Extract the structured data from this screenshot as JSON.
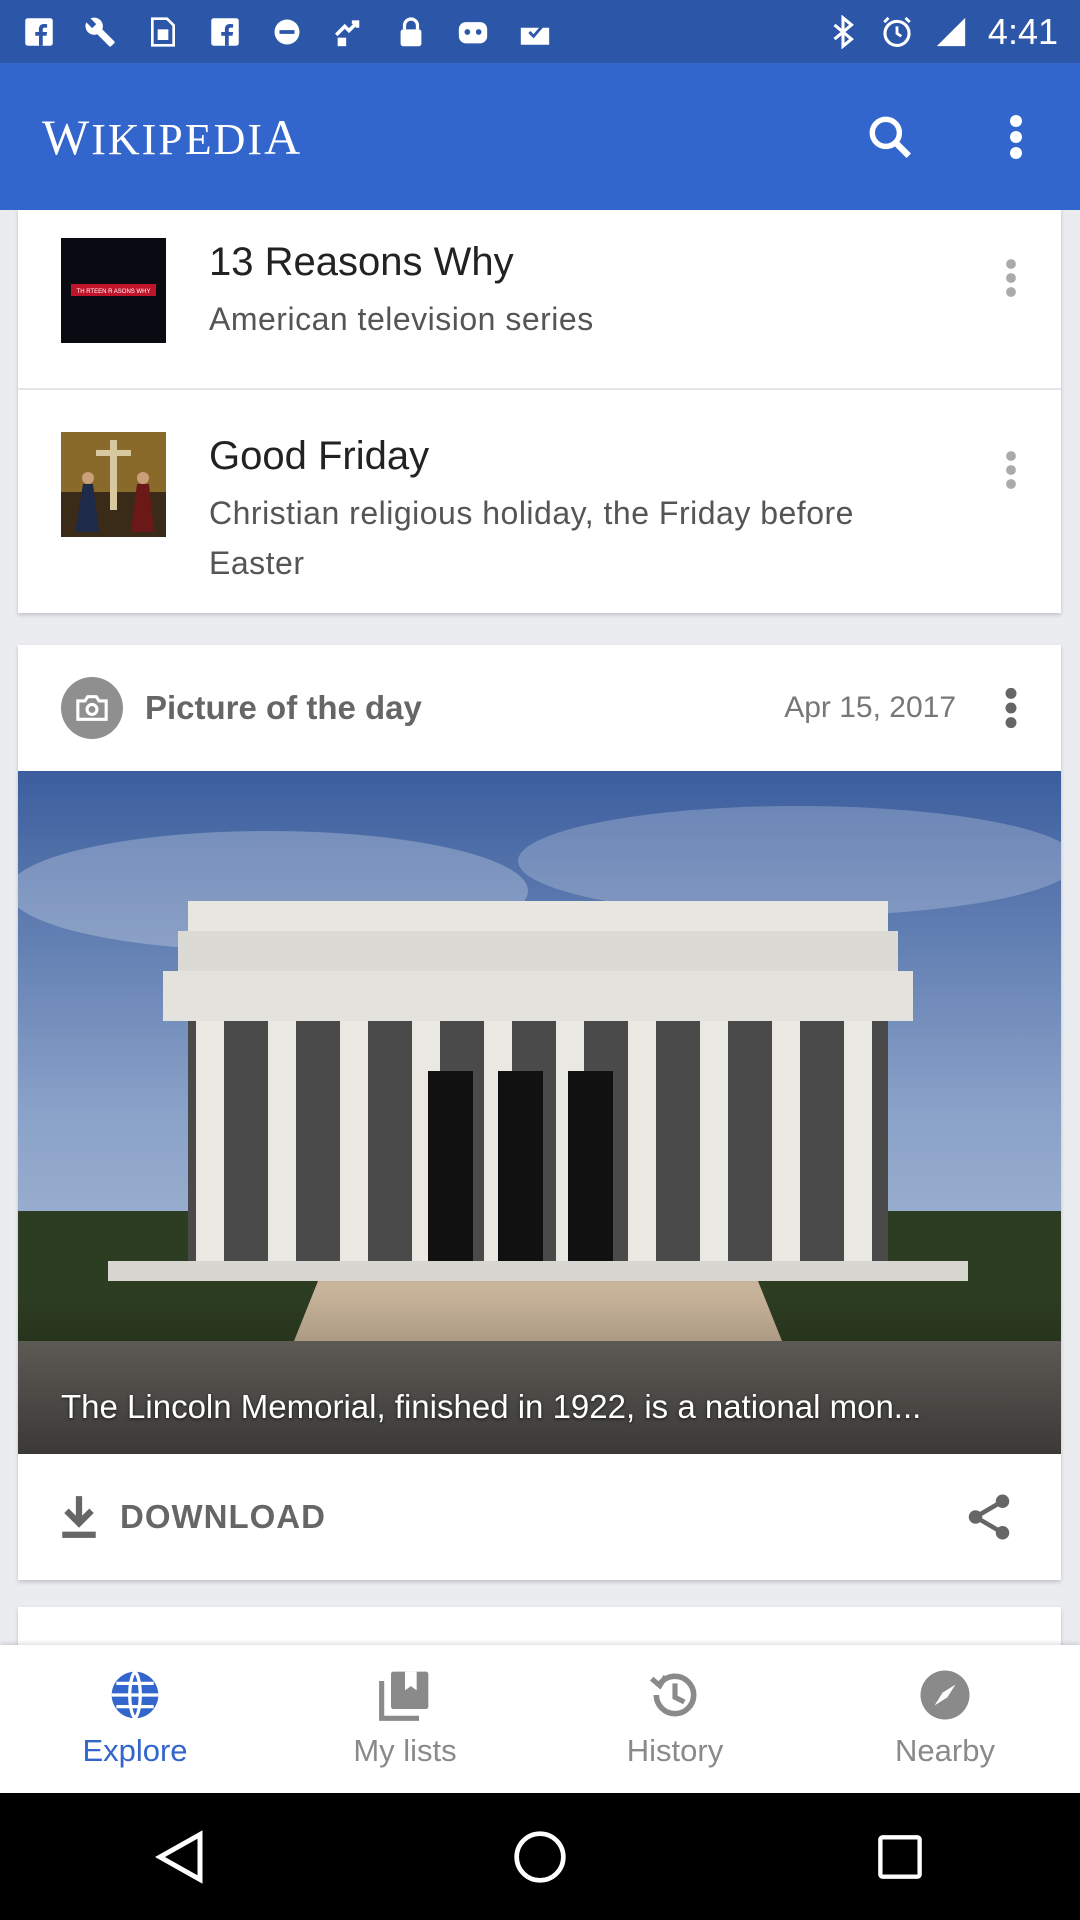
{
  "status_bar": {
    "time": "4:41",
    "left_icons": [
      "facebook-icon",
      "wrench-icon",
      "sim-icon",
      "facebook-icon",
      "no-disturb-icon",
      "fake-gps-icon",
      "lock-icon",
      "robot-icon",
      "inbox-icon"
    ],
    "right_icons": [
      "bluetooth-icon",
      "alarm-icon",
      "signal-icon"
    ]
  },
  "app_bar": {
    "title": "Wikipedia",
    "wordmark": {
      "w": "W",
      "ikipedi": "IKIPEDI",
      "a": "A"
    },
    "search_icon": "search-icon",
    "menu_icon": "more-vert-icon"
  },
  "list_card": {
    "items": [
      {
        "title": "13 Reasons Why",
        "description": "American television series",
        "thumb_text": "TH RTEEN R ASONS WHY"
      },
      {
        "title": "Good Friday",
        "description": "Christian religious holiday, the Friday before Easter"
      }
    ]
  },
  "potd": {
    "header": "Picture of the day",
    "date": "Apr 15, 2017",
    "caption": "The Lincoln Memorial, finished in 1922, is a national mon...",
    "download_label": "DOWNLOAD"
  },
  "bottom_nav": {
    "items": [
      {
        "label": "Explore",
        "icon": "globe-icon",
        "active": true
      },
      {
        "label": "My lists",
        "icon": "lists-icon",
        "active": false
      },
      {
        "label": "History",
        "icon": "history-icon",
        "active": false
      },
      {
        "label": "Nearby",
        "icon": "compass-icon",
        "active": false
      }
    ]
  },
  "colors": {
    "app_bar": "#3366cc",
    "status_bar": "#2c56a8",
    "active_nav": "#3366cc",
    "inactive_nav": "#8a8a8a"
  }
}
